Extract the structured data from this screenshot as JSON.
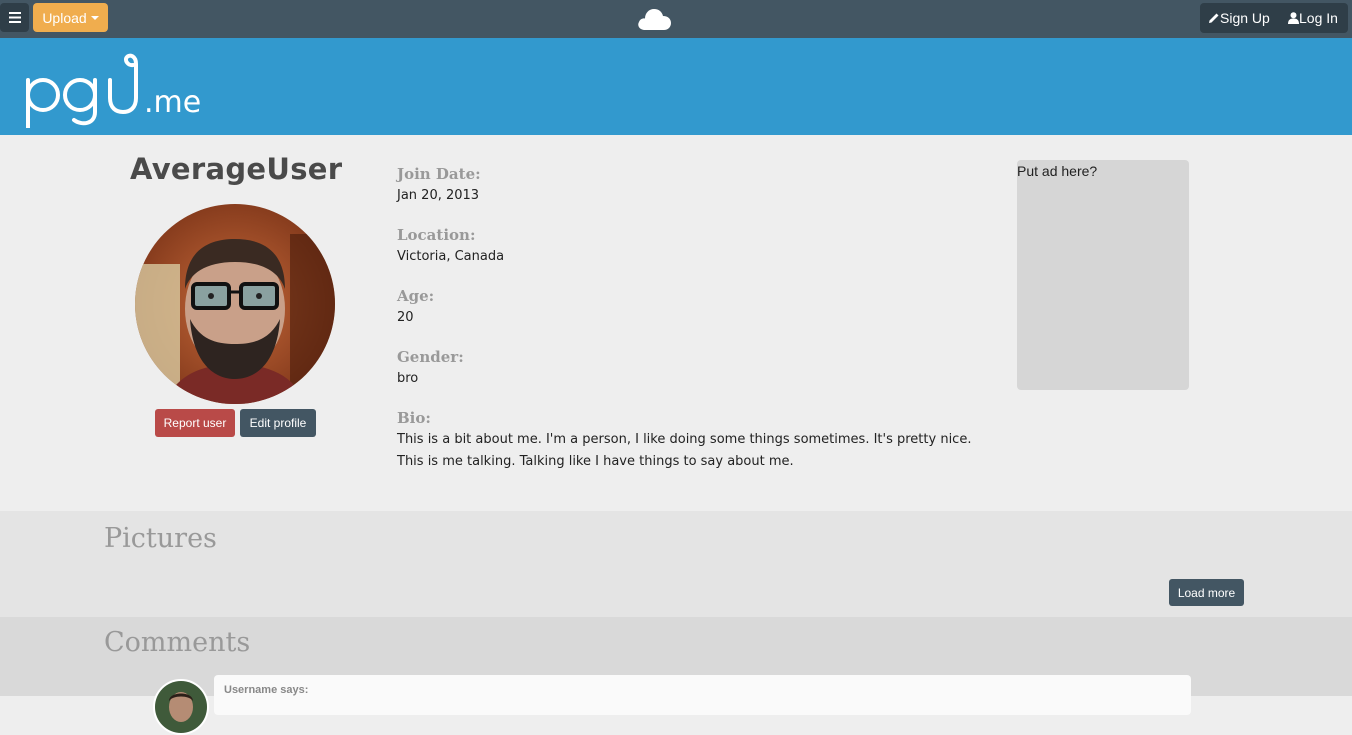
{
  "topbar": {
    "upload_label": "Upload",
    "signup_label": "Sign Up",
    "login_label": "Log In",
    "menu_icon": "hamburger-icon",
    "cloud_icon": "cloud-icon",
    "colors": {
      "bar": "#435663",
      "upload": "#f0ad4e"
    }
  },
  "banner": {
    "logo_text": "pgu.me",
    "color": "#3299ce"
  },
  "profile": {
    "username": "AverageUser",
    "report_label": "Report user",
    "edit_label": "Edit profile",
    "fields": [
      {
        "label": "Join Date:",
        "value": "Jan 20, 2013"
      },
      {
        "label": "Location:",
        "value": "Victoria, Canada"
      },
      {
        "label": "Age:",
        "value": "20"
      },
      {
        "label": "Gender:",
        "value": "bro"
      },
      {
        "label": "Bio:",
        "value": "This is a bit about me. I'm a person, I like doing some things sometimes. It's pretty nice. This is me talking. Talking like I have things to say about me."
      }
    ]
  },
  "ad": {
    "text": "Put ad here?"
  },
  "pictures": {
    "title": "Pictures",
    "load_more_label": "Load more"
  },
  "comments": {
    "title": "Comments",
    "items": [
      {
        "author": "Username says:"
      }
    ]
  }
}
